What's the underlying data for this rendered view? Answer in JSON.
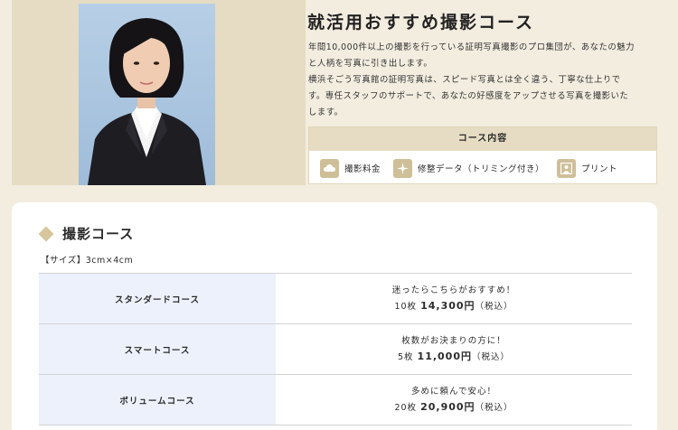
{
  "header": {
    "title": "就活用おすすめ撮影コース",
    "description": [
      "年間10,000件以上の撮影を行っている証明写真撮影のプロ集団が、あなたの魅力",
      "と人柄を写真に引き出します。",
      "横浜そごう写真館の証明写真は、スピード写真とは全く違う、丁寧な仕上りで",
      "す。専任スタッフのサポートで、あなたの好感度をアップさせる写真を撮影いた",
      "します。"
    ]
  },
  "course_box": {
    "title": "コース内容",
    "items": [
      {
        "label": "撮影料金",
        "icon": "cloud-icon"
      },
      {
        "label": "修整データ（トリミング付き）",
        "icon": "sparkle-icon"
      },
      {
        "label": "プリント",
        "icon": "portrait-print-icon"
      }
    ]
  },
  "section": {
    "title": "撮影コース",
    "size_label": "【サイズ】3cm×4cm",
    "plans": [
      {
        "name": "スタンダードコース",
        "tagline": "迷ったらこちらがおすすめ！",
        "count": "10枚",
        "price": "14,300円",
        "tax": "（税込）"
      },
      {
        "name": "スマートコース",
        "tagline": "枚数がお決まりの方に！",
        "count": "5枚",
        "price": "11,000円",
        "tax": "（税込）"
      },
      {
        "name": "ボリュームコース",
        "tagline": "多めに頼んで安心！",
        "count": "20枚",
        "price": "20,900円",
        "tax": "（税込）"
      }
    ]
  },
  "colors": {
    "page_bg": "#f3ede0",
    "beige": "#e6dcc3",
    "icon_bg": "#cfbf98",
    "plan_name_bg": "#ecf1fb"
  }
}
